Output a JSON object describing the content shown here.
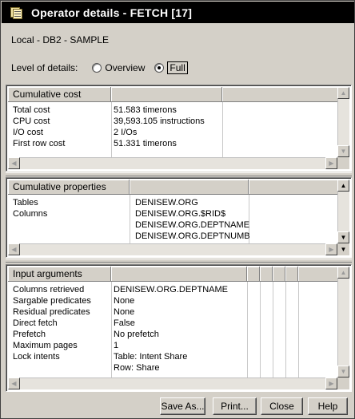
{
  "window": {
    "title": "Operator details - FETCH [17]"
  },
  "context": "Local - DB2 - SAMPLE",
  "level": {
    "label": "Level of details:",
    "options": [
      "Overview",
      "Full"
    ],
    "selected": "Full"
  },
  "cumulative_cost": {
    "header": "Cumulative cost",
    "rows": [
      {
        "name": "Total cost",
        "value": "51.583 timerons"
      },
      {
        "name": "CPU cost",
        "value": "39,593.105 instructions"
      },
      {
        "name": "I/O cost",
        "value": "2 I/Os"
      },
      {
        "name": "First row cost",
        "value": "51.331 timerons"
      }
    ]
  },
  "cumulative_properties": {
    "header": "Cumulative properties",
    "rows": [
      {
        "name": "Tables",
        "values": [
          "DENISEW.ORG"
        ]
      },
      {
        "name": "Columns",
        "values": [
          "DENISEW.ORG.$RID$",
          "DENISEW.ORG.DEPTNAME",
          "DENISEW.ORG.DEPTNUMB"
        ]
      }
    ]
  },
  "input_arguments": {
    "header": "Input arguments",
    "rows": [
      {
        "name": "Columns retrieved",
        "values": [
          "DENISEW.ORG.DEPTNAME"
        ]
      },
      {
        "name": "Sargable predicates",
        "values": [
          "None"
        ]
      },
      {
        "name": "Residual predicates",
        "values": [
          "None"
        ]
      },
      {
        "name": "Direct fetch",
        "values": [
          "False"
        ]
      },
      {
        "name": "Prefetch",
        "values": [
          "No prefetch"
        ]
      },
      {
        "name": "Maximum pages",
        "values": [
          "1"
        ]
      },
      {
        "name": "Lock intents",
        "values": [
          "Table: Intent Share",
          "Row: Share"
        ]
      }
    ]
  },
  "buttons": {
    "save_as": "Save As...",
    "print": "Print...",
    "close": "Close",
    "help": "Help"
  },
  "icons": {
    "app": "operator-details-icon",
    "scroll_up": "▲",
    "scroll_down": "▼",
    "scroll_left": "◀",
    "scroll_right": "▶"
  }
}
